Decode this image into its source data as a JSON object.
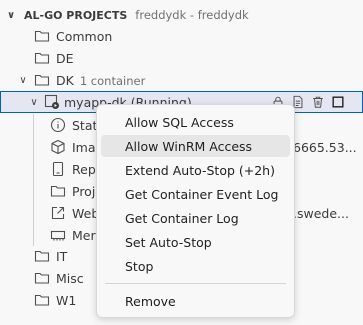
{
  "explorer": {
    "header_title": "AL-GO PROJECTS",
    "header_desc": "freddydk - freddydk",
    "tree": {
      "common": "Common",
      "de": "DE",
      "dk": "DK",
      "dk_desc": "1 container",
      "container": "myapp-dk (Running)",
      "child_status": "Stat",
      "child_image": "Ima",
      "child_image_suffix": "6665.53...",
      "child_rep": "Rep",
      "child_proj": "Proj",
      "child_web": "Web",
      "child_web_suffix": ".swede...",
      "child_mem": "Mer",
      "it": "IT",
      "misc": "Misc",
      "w1": "W1"
    }
  },
  "context_menu": {
    "items": [
      "Allow SQL Access",
      "Allow WinRM Access",
      "Extend Auto-Stop (+2h)",
      "Get Container Event Log",
      "Get Container Log",
      "Set Auto-Stop",
      "Stop"
    ],
    "remove": "Remove",
    "hovered_index": 1
  }
}
